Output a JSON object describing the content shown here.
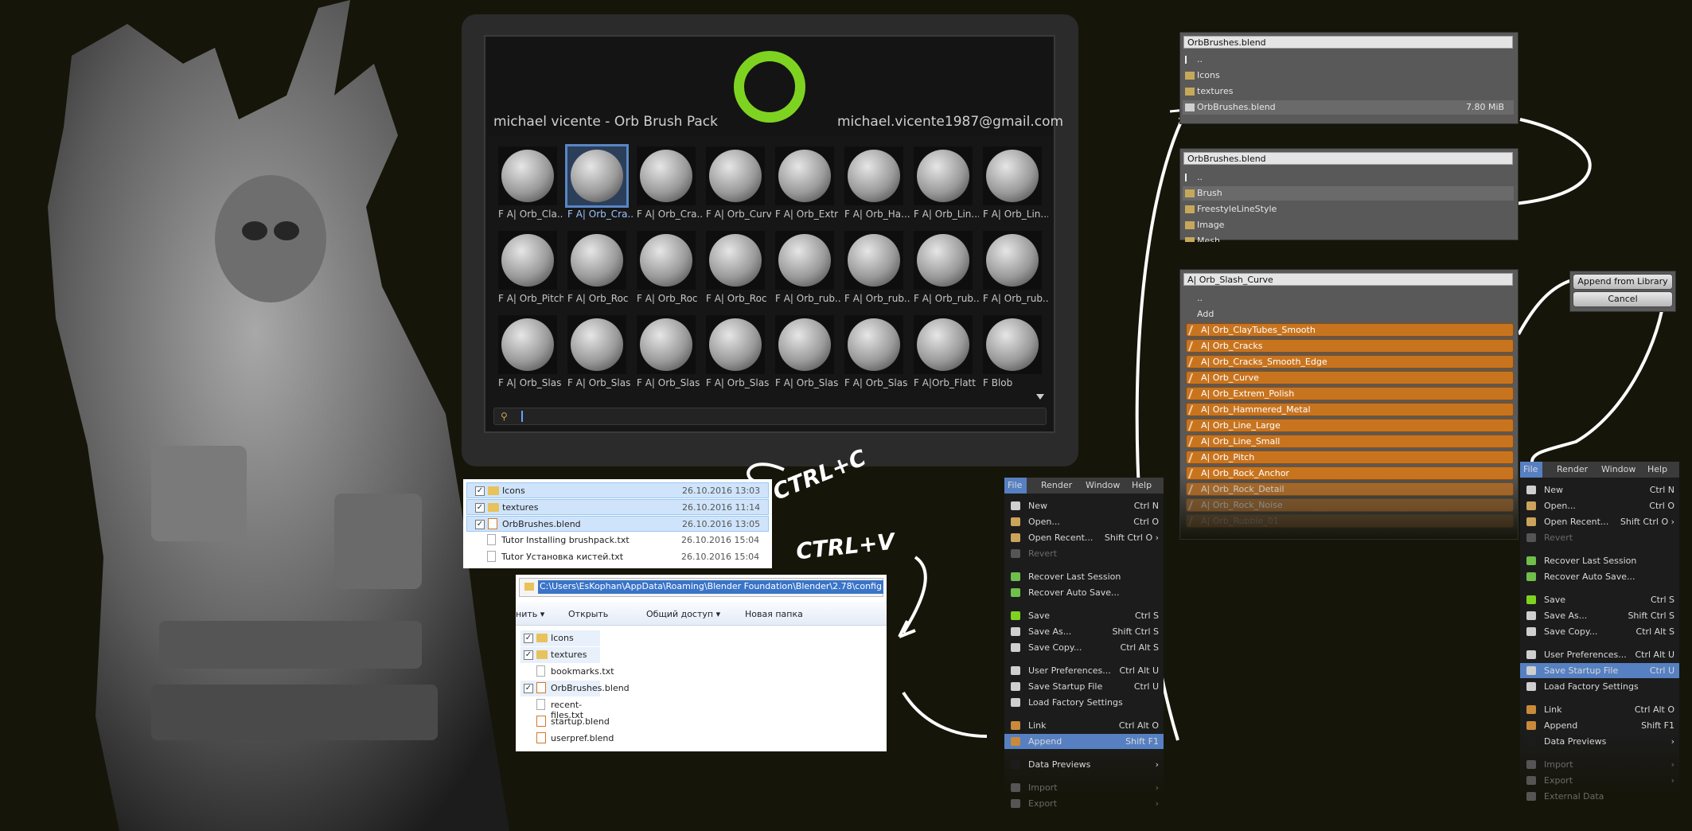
{
  "brush_pack": {
    "author": "michael vicente - Orb Brush Pack",
    "email": "michael.vicente1987@gmail.com",
    "accent_color": "#7ed321",
    "brushes": [
      [
        "F A| Orb_Cla...",
        "F A| Orb_Cra...",
        "F A| Orb_Cra...",
        "F A| Orb_Curv",
        "F A| Orb_Extr",
        "F A| Orb_Ha...",
        "F A| Orb_Lin...",
        "F A| Orb_Lin..."
      ],
      [
        "F A| Orb_Pitch",
        "F A| Orb_Roc",
        "F A| Orb_Roc",
        "F A| Orb_Roc",
        "F A| Orb_rub...",
        "F A| Orb_rub...",
        "F A| Orb_rub...",
        "F A| Orb_rub..."
      ],
      [
        "F A| Orb_Slas",
        "F A| Orb_Slas",
        "F A| Orb_Slas",
        "F A| Orb_Slas",
        "F A| Orb_Slas",
        "F A| Orb_Slas",
        "F A|Orb_Flatt",
        "F Blob"
      ]
    ],
    "selected_brush": "F A| Orb_Cra...",
    "search_icon": "magnifier-icon"
  },
  "explorer_source": {
    "rows": [
      {
        "name": "Icons",
        "date": "26.10.2016 13:03",
        "checked": "✓",
        "type": "folder"
      },
      {
        "name": "textures",
        "date": "26.10.2016 11:14",
        "checked": "✓",
        "type": "folder"
      },
      {
        "name": "OrbBrushes.blend",
        "date": "26.10.2016 13:05",
        "checked": "✓",
        "type": "blend"
      },
      {
        "name": "Tutor Installing brushpack.txt",
        "date": "26.10.2016 15:04",
        "checked": "",
        "type": "file"
      },
      {
        "name": "Tutor Установка кистей.txt",
        "date": "26.10.2016 15:04",
        "checked": "",
        "type": "file"
      }
    ]
  },
  "explorer_dest": {
    "address": "C:\\Users\\EsKophan\\AppData\\Roaming\\Blender Foundation\\Blender\\2.78\\config",
    "toolbar": [
      "нить ▾",
      "Открыть",
      "Общий доступ ▾",
      "Новая папка"
    ],
    "rows": [
      {
        "name": "Icons",
        "checked": "✓",
        "type": "folder"
      },
      {
        "name": "textures",
        "checked": "✓",
        "type": "folder"
      },
      {
        "name": "bookmarks.txt",
        "checked": "",
        "type": "file"
      },
      {
        "name": "OrbBrushes.blend",
        "checked": "✓",
        "type": "blend"
      },
      {
        "name": "recent-files.txt",
        "checked": "",
        "type": "file"
      },
      {
        "name": "startup.blend",
        "checked": "",
        "type": "blend"
      },
      {
        "name": "userpref.blend",
        "checked": "",
        "type": "blend"
      }
    ]
  },
  "annotations": {
    "copy": "CTRL+C",
    "paste": "CTRL+V"
  },
  "blender_menu_left": {
    "bar": [
      "File",
      "Render",
      "Window",
      "Help"
    ],
    "items": [
      {
        "label": "New",
        "shortcut": "Ctrl N"
      },
      {
        "label": "Open...",
        "shortcut": "Ctrl O"
      },
      {
        "label": "Open Recent...",
        "shortcut": "Shift Ctrl O ›"
      },
      {
        "label": "Revert",
        "shortcut": ""
      },
      {
        "label": "Recover Last Session",
        "shortcut": ""
      },
      {
        "label": "Recover Auto Save...",
        "shortcut": ""
      },
      {
        "label": "Save",
        "shortcut": "Ctrl S"
      },
      {
        "label": "Save As...",
        "shortcut": "Shift Ctrl S"
      },
      {
        "label": "Save Copy...",
        "shortcut": "Ctrl Alt S"
      },
      {
        "label": "User Preferences...",
        "shortcut": "Ctrl Alt U"
      },
      {
        "label": "Save Startup File",
        "shortcut": "Ctrl U"
      },
      {
        "label": "Load Factory Settings",
        "shortcut": ""
      },
      {
        "label": "Link",
        "shortcut": "Ctrl Alt O"
      },
      {
        "label": "Append",
        "shortcut": "Shift F1"
      },
      {
        "label": "Data Previews",
        "shortcut": "›"
      },
      {
        "label": "Import",
        "shortcut": "›"
      },
      {
        "label": "Export",
        "shortcut": "›"
      }
    ],
    "highlight_color": "#5680c2"
  },
  "blender_menu_right": {
    "bar": [
      "File",
      "Render",
      "Window",
      "Help"
    ],
    "items": [
      {
        "label": "New",
        "shortcut": "Ctrl N"
      },
      {
        "label": "Open...",
        "shortcut": "Ctrl O"
      },
      {
        "label": "Open Recent...",
        "shortcut": "Shift Ctrl O ›"
      },
      {
        "label": "Revert",
        "shortcut": ""
      },
      {
        "label": "Recover Last Session",
        "shortcut": ""
      },
      {
        "label": "Recover Auto Save...",
        "shortcut": ""
      },
      {
        "label": "Save",
        "shortcut": "Ctrl S"
      },
      {
        "label": "Save As...",
        "shortcut": "Shift Ctrl S"
      },
      {
        "label": "Save Copy...",
        "shortcut": "Ctrl Alt S"
      },
      {
        "label": "User Preferences...",
        "shortcut": "Ctrl Alt U"
      },
      {
        "label": "Save Startup File",
        "shortcut": "Ctrl U"
      },
      {
        "label": "Load Factory Settings",
        "shortcut": ""
      },
      {
        "label": "Link",
        "shortcut": "Ctrl Alt O"
      },
      {
        "label": "Append",
        "shortcut": "Shift F1"
      },
      {
        "label": "Data Previews",
        "shortcut": "›"
      },
      {
        "label": "Import",
        "shortcut": "›"
      },
      {
        "label": "Export",
        "shortcut": "›"
      },
      {
        "label": "External Data",
        "shortcut": ""
      }
    ]
  },
  "file_browser_1": {
    "title": "OrbBrushes.blend",
    "rows": [
      {
        "name": ".."
      },
      {
        "name": "Icons"
      },
      {
        "name": "textures"
      },
      {
        "name": "OrbBrushes.blend",
        "size": "7.80 MiB"
      }
    ]
  },
  "file_browser_2": {
    "title": "OrbBrushes.blend",
    "rows": [
      {
        "name": ".."
      },
      {
        "name": "Brush"
      },
      {
        "name": "FreestyleLineStyle"
      },
      {
        "name": "Image"
      },
      {
        "name": "Mesh"
      }
    ]
  },
  "file_browser_3": {
    "title": "A| Orb_Slash_Curve",
    "up": "..",
    "add": "Add",
    "items": [
      "A| Orb_ClayTubes_Smooth",
      "A| Orb_Cracks",
      "A| Orb_Cracks_Smooth_Edge",
      "A| Orb_Curve",
      "A| Orb_Extrem_Polish",
      "A| Orb_Hammered_Metal",
      "A| Orb_Line_Large",
      "A| Orb_Line_Small",
      "A| Orb_Pitch",
      "A| Orb_Rock_Anchor",
      "A| Orb_Rock_Detail",
      "A| Orb_Rock_Noise",
      "A| Orb_Rubble_01"
    ],
    "item_color": "#c8741f"
  },
  "append_buttons": {
    "append": "Append from Library",
    "cancel": "Cancel"
  }
}
